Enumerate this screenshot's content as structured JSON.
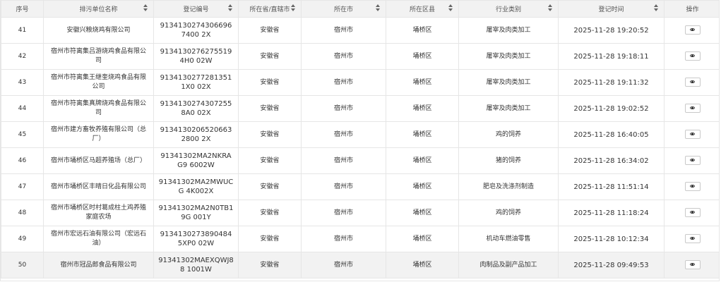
{
  "table": {
    "columns": [
      {
        "label": "序号",
        "sortable": false
      },
      {
        "label": "排污单位名称",
        "sortable": true
      },
      {
        "label": "登记编号",
        "sortable": true
      },
      {
        "label": "所在省/直辖市",
        "sortable": true
      },
      {
        "label": "所在市",
        "sortable": true
      },
      {
        "label": "所在区县",
        "sortable": true
      },
      {
        "label": "行业类别",
        "sortable": true
      },
      {
        "label": "登记时间",
        "sortable": true
      },
      {
        "label": "操作",
        "sortable": false
      }
    ],
    "rows": [
      {
        "index": "41",
        "name": "安徽兴粮烧鸡有限公司",
        "code": "91341302743066967400 2X",
        "province": "安徽省",
        "city": "宿州市",
        "district": "埇桥区",
        "industry": "屠宰及肉类加工",
        "time": "2025-11-28 19:20:52"
      },
      {
        "index": "42",
        "name": "宿州市符离集吕游烧鸡食品有限公司",
        "code": "91341302762755194H0 02W",
        "province": "安徽省",
        "city": "宿州市",
        "district": "埇桥区",
        "industry": "屠宰及肉类加工",
        "time": "2025-11-28 19:18:11"
      },
      {
        "index": "43",
        "name": "宿州市符离集王继奎烧鸡食品有限公司",
        "code": "91341302772813511X0 02X",
        "province": "安徽省",
        "city": "宿州市",
        "district": "埇桥区",
        "industry": "屠宰及肉类加工",
        "time": "2025-11-28 19:11:32"
      },
      {
        "index": "44",
        "name": "宿州市符离集真牌烧鸡食品有限公司",
        "code": "91341302743072558A0 02X",
        "province": "安徽省",
        "city": "宿州市",
        "district": "埇桥区",
        "industry": "屠宰及肉类加工",
        "time": "2025-11-28 19:02:52"
      },
      {
        "index": "45",
        "name": "宿州市建方畜牧养殖有限公司（总厂）",
        "code": "91341302065206632800 2X",
        "province": "安徽省",
        "city": "宿州市",
        "district": "埇桥区",
        "industry": "鸡的饲养",
        "time": "2025-11-28 16:40:05"
      },
      {
        "index": "46",
        "name": "宿州市埇桥区马超养殖场（总厂）",
        "code": "91341302MA2NKRAG9 6002W",
        "province": "安徽省",
        "city": "宿州市",
        "district": "埇桥区",
        "industry": "猪的饲养",
        "time": "2025-11-28 16:34:02"
      },
      {
        "index": "47",
        "name": "宿州市埇桥区丰晴日化品有限公司",
        "code": "91341302MA2MWUCG 4K002X",
        "province": "安徽省",
        "city": "宿州市",
        "district": "埇桥区",
        "industry": "肥皂及洗涤剂制造",
        "time": "2025-11-28 11:51:14"
      },
      {
        "index": "48",
        "name": "宿州市埇桥区时村葛成柱土鸡养殖家庭农场",
        "code": "91341302MA2N0TB19G 001Y",
        "province": "安徽省",
        "city": "宿州市",
        "district": "埇桥区",
        "industry": "鸡的饲养",
        "time": "2025-11-28 11:18:24"
      },
      {
        "index": "49",
        "name": "宿州市宏远石油有限公司（宏远石油）",
        "code": "91341302738904845XP0 02W",
        "province": "安徽省",
        "city": "宿州市",
        "district": "埇桥区",
        "industry": "机动车燃油零售",
        "time": "2025-11-28 10:12:34"
      },
      {
        "index": "50",
        "name": "宿州市冠品郎食品有限公司",
        "code": "91341302MAEXQWJ88 1001W",
        "province": "安徽省",
        "city": "宿州市",
        "district": "埇桥区",
        "industry": "肉制品及副产品加工",
        "time": "2025-11-28 09:49:53"
      }
    ],
    "selected_row": 9,
    "action_icon": "eye-icon"
  },
  "colors": {
    "header_bg": "#f2f2f2",
    "border": "#e6e6e6",
    "selected_row_bg": "#f2f2f2",
    "text": "#333333"
  }
}
